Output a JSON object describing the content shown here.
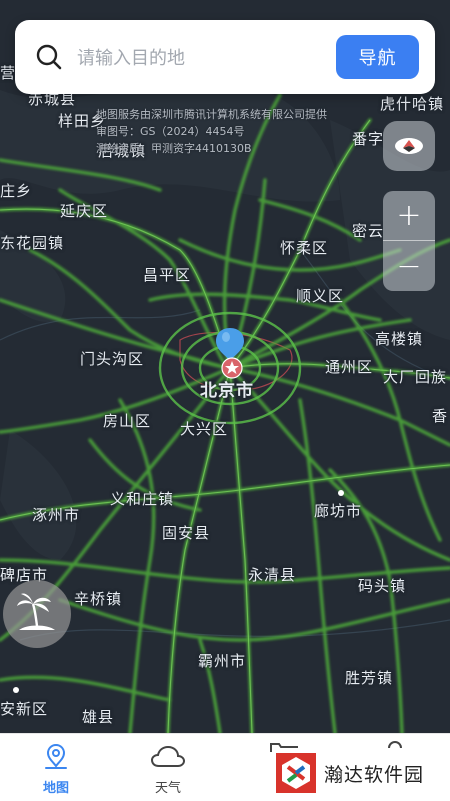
{
  "search": {
    "placeholder": "请输入目的地",
    "nav_label": "导航"
  },
  "map": {
    "credit_lines": [
      "地图服务由深圳市腾讯计算机系统有限公司提供",
      "审图号：GS（2024）4454号",
      "测绘资质：甲测资字4410130B"
    ],
    "places": {
      "partial_top": "赤城县",
      "yangtian": "样田乡",
      "houcheng": "后城镇",
      "huqiao": "虎什哈镇",
      "fanzi": "番字",
      "zhuang": "庄乡",
      "yanqing": "延庆区",
      "donghuayuan": "东花园镇",
      "huairou": "怀柔区",
      "miyun": "密云",
      "changping": "昌平区",
      "shunyi": "顺义区",
      "mentougou": "门头沟区",
      "gaolou": "高楼镇",
      "tongzhou": "通州区",
      "dachang": "大厂回族",
      "beijing": "北京市",
      "fangshan": "房山区",
      "daxing": "大兴区",
      "xiang": "香",
      "yiheyuan": "义和庄镇",
      "zhuozhou": "涿州市",
      "langfang": "廊坊市",
      "guan": "固安县",
      "beidian": "碑店市",
      "xinqiao": "辛桥镇",
      "yongqing": "永清县",
      "mapo": "码头镇",
      "bazhou": "霸州市",
      "shengfang": "胜芳镇",
      "anxin": "安新区",
      "xiongxian": "雄县",
      "ying": "营"
    }
  },
  "controls": {
    "zoom_in": "+",
    "zoom_out": "−"
  },
  "tabs": [
    {
      "label": "地图"
    },
    {
      "label": "天气"
    }
  ],
  "watermark": {
    "text": "瀚达软件园"
  },
  "colors": {
    "accent": "#3b7ff2",
    "road": "#5fc24a",
    "map_bg": "#242b34"
  }
}
